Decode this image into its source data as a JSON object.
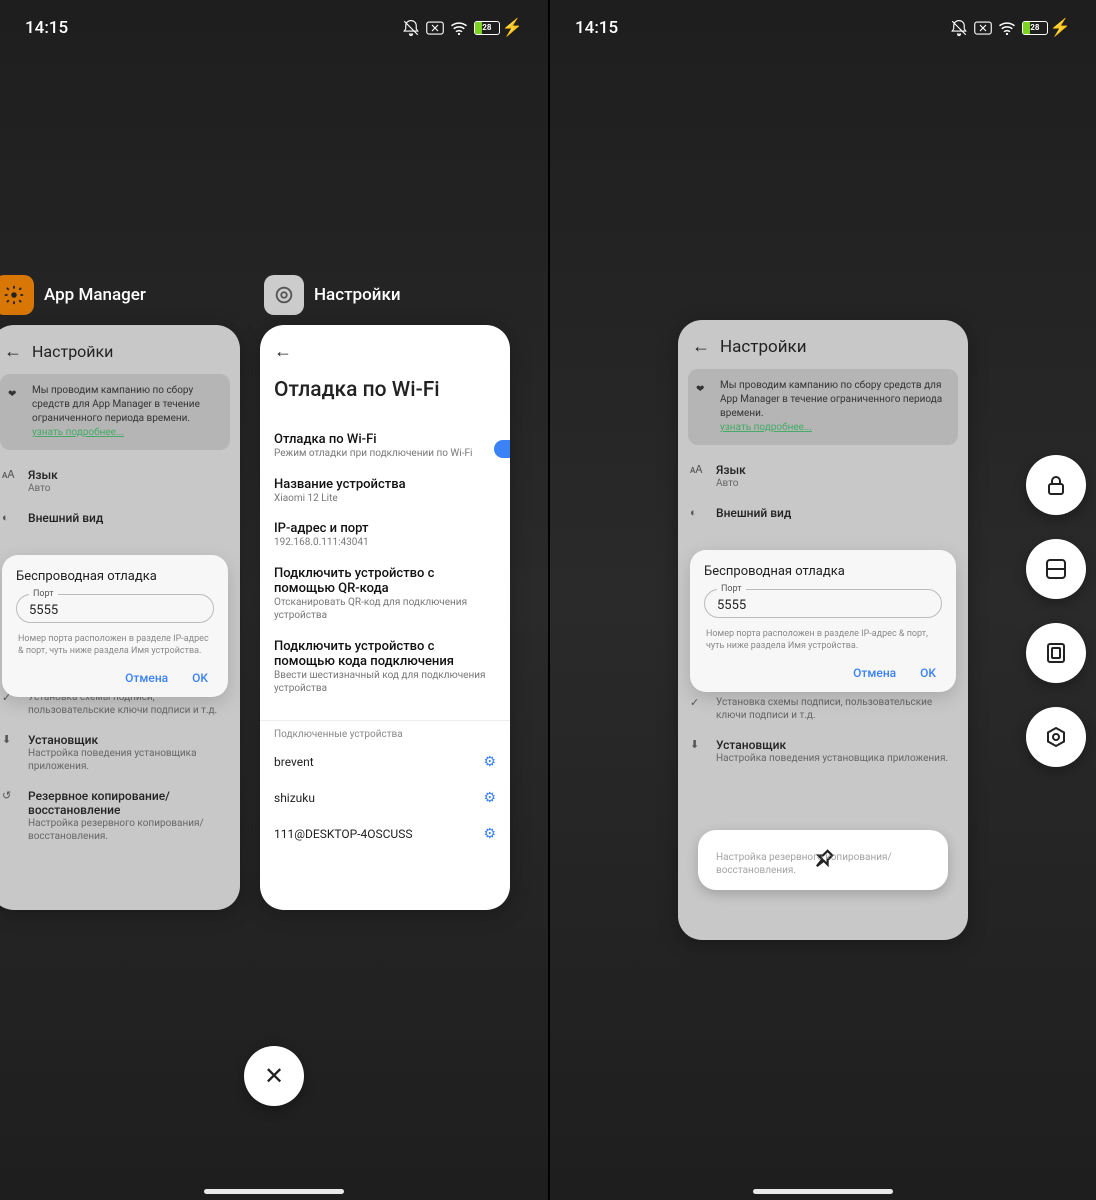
{
  "status": {
    "time": "14:15",
    "battery": "28"
  },
  "apps": {
    "left": {
      "name": "App Manager"
    },
    "right": {
      "name": "Настройки"
    }
  },
  "appmgr": {
    "header": "Настройки",
    "banner": "Мы проводим кампанию по сбору средств для App Manager в течение ограниченного периода времени.",
    "banner_link": "узнать подробнее...",
    "rows": {
      "lang_t": "Язык",
      "lang_s": "Авто",
      "appearance_t": "Внешний вид",
      "sign_t": "Установка схемы подписи, пользовательские ключи подписи и т.д.",
      "installer_t": "Установщик",
      "installer_s": "Настройка поведения установщика приложения.",
      "backup_t": "Резервное копирование/восстановление",
      "backup_s": "Настройка резервного копирования/восстановления."
    }
  },
  "dialog": {
    "title": "Беспроводная отладка",
    "field_label": "Порт",
    "field_value": "5555",
    "hint": "Номер порта расположен в разделе IP-адрес & порт, чуть ниже раздела Имя устройства.",
    "cancel": "Отмена",
    "ok": "OK"
  },
  "wifi": {
    "header": "Отладка по Wi-Fi",
    "toggle_t": "Отладка по Wi-Fi",
    "toggle_s": "Режим отладки при подключении по Wi-Fi",
    "name_t": "Название устройства",
    "name_v": "Xiaomi 12 Lite",
    "ip_t": "IP-адрес и порт",
    "ip_v": "192.168.0.111:43041",
    "qr_t": "Подключить устройство с помощью QR-кода",
    "qr_s": "Отсканировать QR-код для подключения устройства",
    "code_t": "Подключить устройство с помощью кода подключения",
    "code_s": "Ввести шестизначный код для подключения устройства",
    "devices_hdr": "Подключенные устройства",
    "devs": [
      "brevent",
      "shizuku",
      "111@DESKTOP-4OSCUSS"
    ]
  }
}
